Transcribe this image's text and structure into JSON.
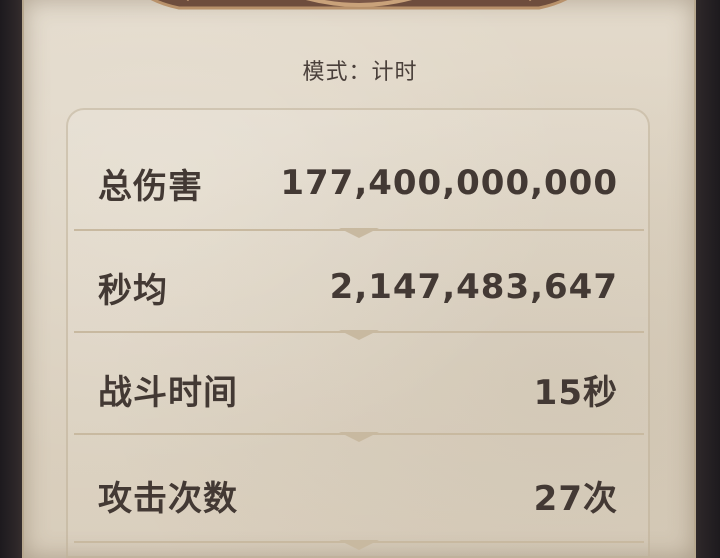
{
  "header": {
    "mode_text": "模式：计时"
  },
  "stats": [
    {
      "label": "总伤害",
      "value": "177,400,000,000"
    },
    {
      "label": "秒均",
      "value": "2,147,483,647"
    },
    {
      "label": "战斗时间",
      "value": "15秒"
    },
    {
      "label": "攻击次数",
      "value": "27次"
    }
  ],
  "colors": {
    "parchment": "#ddd3c2",
    "text": "#433934",
    "frame": "#b7a88f",
    "background": "#2a2226"
  }
}
